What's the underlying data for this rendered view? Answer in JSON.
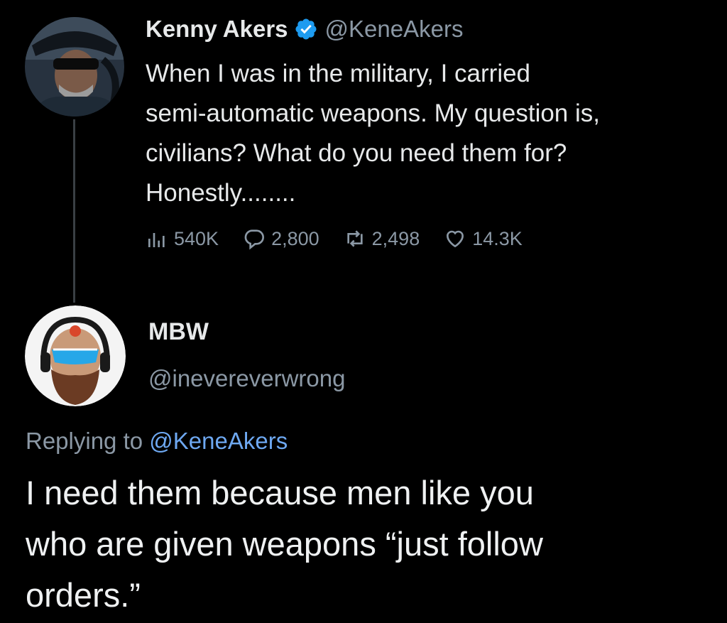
{
  "original_tweet": {
    "display_name": "Kenny Akers",
    "verified_icon": "verified-badge-icon",
    "handle": "@KeneAkers",
    "text": "When I was in the military, I carried\nsemi-automatic weapons. My question is,\ncivilians? What do you need them for?\nHonestly........",
    "metrics": {
      "views": "540K",
      "replies": "2,800",
      "retweets": "2,498",
      "likes": "14.3K"
    }
  },
  "reply_tweet": {
    "display_name": "MBW",
    "handle": "@inevereverwrong",
    "replying_prefix": "Replying to",
    "replying_to": "@KeneAkers",
    "text": "I need them because men like you\nwho are given weapons “just follow\norders.”"
  },
  "colors": {
    "background": "#000000",
    "primary_text": "#e7e9ea",
    "secondary_text": "#8b98a5",
    "link": "#6ea8f1",
    "verified": "#1d9bf0",
    "thread_line": "#3a3f44"
  }
}
